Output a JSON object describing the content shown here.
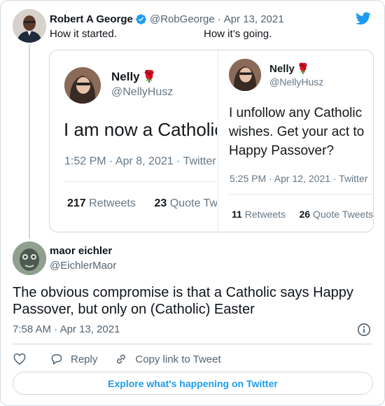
{
  "parent_tweet": {
    "author_name": "Robert A George",
    "author_handle": "@RobGeorge",
    "separator": "·",
    "date": "Apr 13, 2021",
    "text_left": "How it started.",
    "text_right": "How it’s going.",
    "icons": {
      "verified": "verified-badge-icon",
      "brand": "twitter-bird-icon"
    },
    "embedded_left": {
      "name": "Nelly",
      "handle": "@NellyHusz",
      "text": "I am now a Catholic",
      "meta": "1:52 PM · Apr 8, 2021 · Twitter",
      "retweets_count": "217",
      "retweets_label": "Retweets",
      "quotes_count": "23",
      "quotes_label": "Quote Tweets"
    },
    "embedded_right": {
      "name": "Nelly",
      "handle": "@NellyHusz",
      "line1": "I unfollow any Catholic",
      "line2": "wishes. Get your act to",
      "line3": "Happy  Passover?",
      "meta": "5:25 PM · Apr 12, 2021 · Twitter",
      "retweets_count": "11",
      "retweets_label": "Retweets",
      "quotes_count": "26",
      "quotes_label": "Quote Tweets"
    }
  },
  "reply_tweet": {
    "author_name": "maor eichler",
    "author_handle": "@EichlerMaor",
    "text": "The obvious compromise is that a Catholic says Happy Passover, but only on (Catholic) Easter",
    "time": "7:58 AM",
    "separator": "·",
    "date": "Apr 13, 2021"
  },
  "actions": {
    "like_icon": "heart-icon",
    "reply_label": "Reply",
    "copy_label": "Copy link to Tweet"
  },
  "explore_label": "Explore what's happening on Twitter",
  "colors": {
    "accent": "#1d9bf0",
    "text": "#0f1419",
    "secondary": "#536471",
    "border": "#cfd9de",
    "rose": "#d8475c"
  }
}
